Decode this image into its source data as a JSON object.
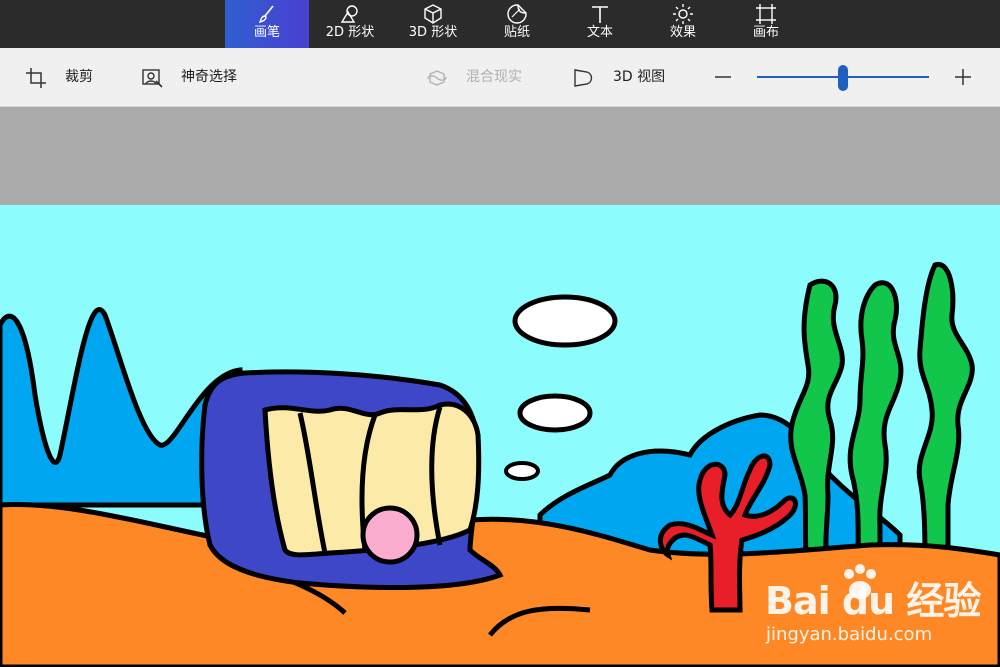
{
  "ribbon": {
    "tabs": [
      {
        "label": "画笔",
        "icon": "brush-icon",
        "active": true
      },
      {
        "label": "2D 形状",
        "icon": "2d-shapes-icon",
        "active": false
      },
      {
        "label": "3D 形状",
        "icon": "3d-cube-icon",
        "active": false
      },
      {
        "label": "贴纸",
        "icon": "sticker-icon",
        "active": false
      },
      {
        "label": "文本",
        "icon": "text-icon",
        "active": false
      },
      {
        "label": "效果",
        "icon": "sun-effects-icon",
        "active": false
      },
      {
        "label": "画布",
        "icon": "canvas-crop-icon",
        "active": false
      }
    ],
    "active_color": "#3b4fd4"
  },
  "toolbar": {
    "crop_label": "裁剪",
    "magic_select_label": "神奇选择",
    "mixed_reality_label": "混合现实",
    "view_3d_label": "3D 视图",
    "zoom_level": 0.5
  },
  "canvas": {
    "background_color": "#8cfcfc"
  },
  "watermark": {
    "brand": "Bai du 经验",
    "site": "jingyan.baidu.com"
  }
}
